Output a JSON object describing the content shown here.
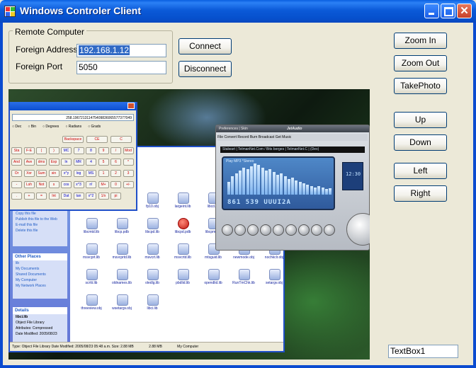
{
  "window": {
    "title": "Windows Controler Client",
    "minimize_label": "",
    "maximize_label": "",
    "close_glyph": "✕"
  },
  "remote_computer": {
    "group_label": "Remote Computer",
    "address_label": "Foreign Address",
    "address_value": "192.168.1.12",
    "port_label": "Foreign Port",
    "port_value": "5050"
  },
  "actions": {
    "connect": "Connect",
    "disconnect": "Disconnect"
  },
  "controls": {
    "zoom_in": "Zoom In",
    "zoom_out": "Zoom Out",
    "take_photo": "TakePhoto",
    "up": "Up",
    "down": "Down",
    "left": "Left",
    "right": "Right"
  },
  "textbox1": "TextBox1",
  "remote_screen": {
    "calculator": {
      "display": "258.196721311475409836065577377049",
      "radios": [
        "Dec",
        "Bin",
        "Degrees",
        "Radians",
        "Grads"
      ],
      "keys_row1": [
        "Backspace",
        "CE",
        "C"
      ],
      "keys": [
        "Sta",
        "F-E",
        "(",
        ")",
        "MC",
        "7",
        "8",
        "9",
        "/",
        "Mod",
        "And",
        "Ave",
        "dms",
        "Exp",
        "ln",
        "MR",
        "4",
        "5",
        "6",
        "*",
        "Or",
        "Xor",
        "Sum",
        "sin",
        "x^y",
        "log",
        "MS",
        "1",
        "2",
        "3",
        "-",
        "Lsh",
        "Not",
        "s",
        "cos",
        "x^3",
        "n!",
        "M+",
        "0",
        "+/-",
        ".",
        "+",
        "=",
        "Int",
        "Dat",
        "tan",
        "x^2",
        "1/x",
        "pi"
      ]
    },
    "explorer": {
      "tasks": [
        "Copy this file",
        "Publish this file to the Web",
        "E-mail this file",
        "Delete this file"
      ],
      "other_places_header": "Other Places",
      "other_places": [
        "lib",
        "My Documents",
        "Shared Documents",
        "My Computer",
        "My Network Places"
      ],
      "details_header": "Details",
      "details_name": "libci.lib",
      "details_type": "Object File Library",
      "details_attr": "Attributes: Compressed",
      "details_date": "Date Modified: 2005/08/23",
      "files": [
        "oldnames.lib",
        "winspool.lib",
        "fp10.obj",
        "largeint.lib",
        "libcd.lib",
        "libcid.pdb",
        "libcmt.lib",
        "libcmtd.lib",
        "libcp.pdb",
        "libcpd.lib",
        "libcpd.pdb",
        "libcpmt.lib",
        "libcpmtd.lib",
        "libcpmtd.pdb",
        "msvcprt.lib",
        "msvcprtd.lib",
        "msvcrt.lib",
        "msvcrtd.lib",
        "mtsguid.lib",
        "newmode.obj",
        "nochkclr.obj",
        "scrtti.lib",
        "oldnames.lib",
        "oledlg.lib",
        "pbdlid.lib",
        "opendlid.lib",
        "RunTmChk.lib",
        "setargv.obj",
        "threeview.obj",
        "wsetargv.obj",
        "libci.lib"
      ],
      "status": "Type: Object File Library Date Modified: 2005/08/23 05:48 a.m. Size: 2.88 MB",
      "status_size": "2.88 MB",
      "status_location": "My Computer"
    },
    "jetaudio": {
      "title": "Preferences | Skin",
      "logo": "JetAudio",
      "menu": "File  Convert  Record  Burn  Broadcast  Get Music",
      "info": "Stalwart  |  TelmanNet.Com / Bits berges  |  TelmanNet.C  |  (Dex)",
      "mode": "Play MP3 *Stereo",
      "digits": "861   539  UUUI2A",
      "clock": "12:30"
    }
  }
}
